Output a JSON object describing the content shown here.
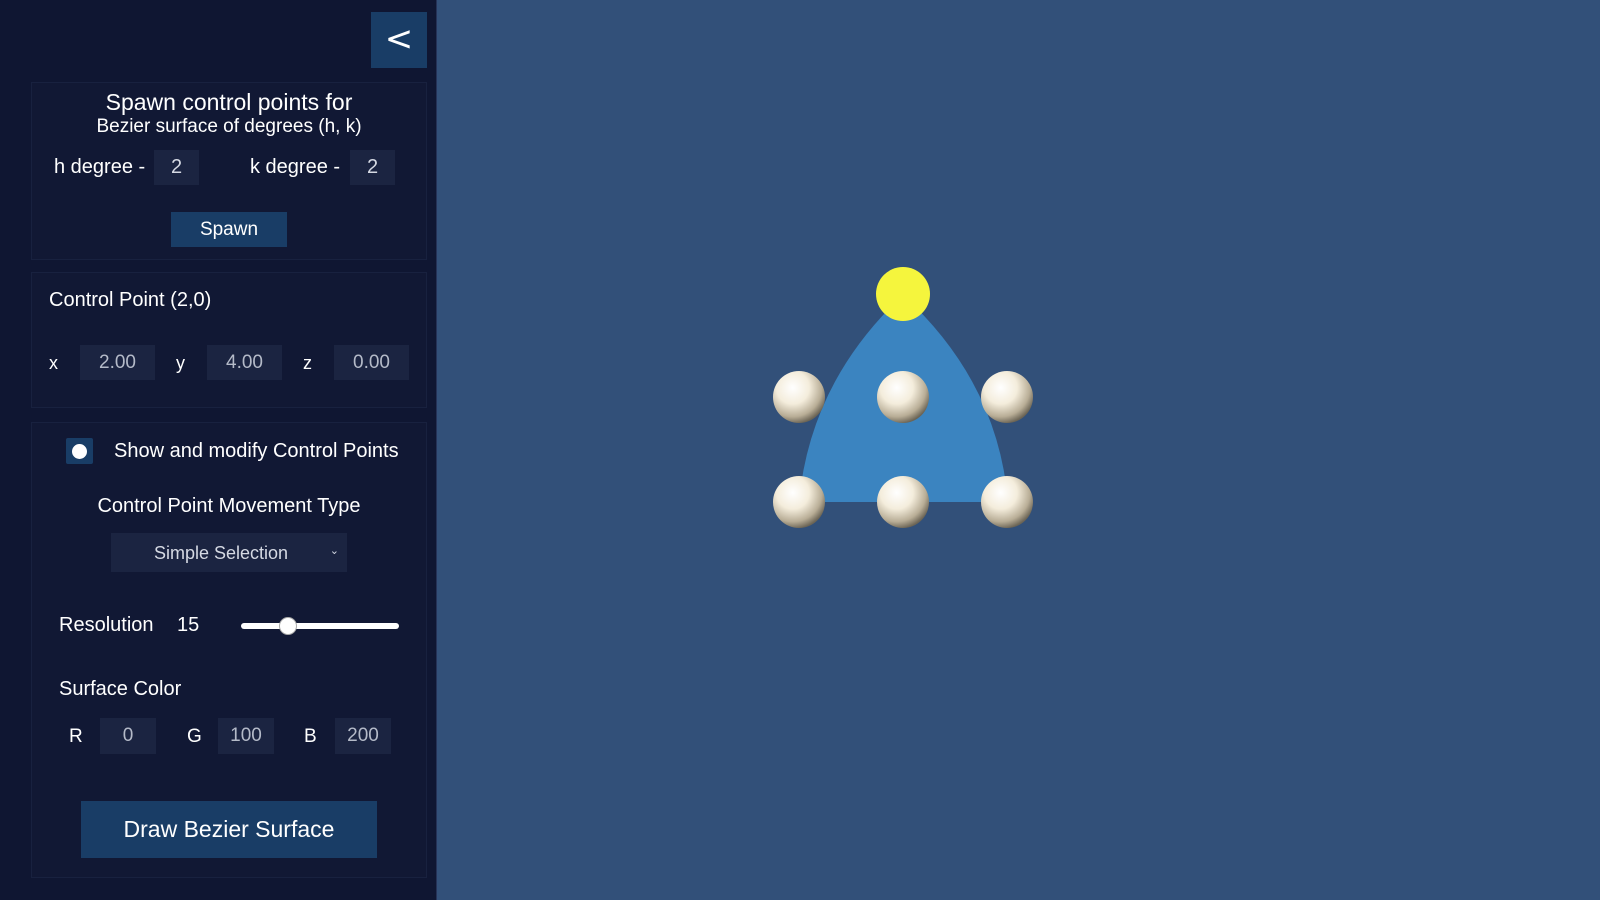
{
  "panel": {
    "collapse_label": "<",
    "spawn": {
      "title": "Spawn control points for",
      "subtitle": "Bezier surface of degrees (h, k)",
      "h_label": "h degree -",
      "h_value": "2",
      "k_label": "k degree -",
      "k_value": "2",
      "spawn_label": "Spawn"
    },
    "control_point": {
      "title": "Control Point (2,0)",
      "x_label": "x",
      "x_value": "2.00",
      "y_label": "y",
      "y_value": "4.00",
      "z_label": "z",
      "z_value": "0.00"
    },
    "options": {
      "show_label": "Show and modify Control Points",
      "show_enabled": true,
      "movement_title": "Control Point Movement Type",
      "movement_selected": "Simple Selection",
      "resolution_label": "Resolution",
      "resolution_value": "15",
      "resolution_fraction": 0.3,
      "color_title": "Surface Color",
      "r_label": "R",
      "r_value": "0",
      "g_label": "G",
      "g_value": "100",
      "b_label": "B",
      "b_value": "200",
      "draw_label": "Draw Bezier Surface"
    }
  },
  "viewport": {
    "background_color": "#325079",
    "surface_color": "#3b84c0",
    "control_point_color": "#f4eddc",
    "selected_point_color": "#f5f53d",
    "selected_point": "2,0"
  }
}
